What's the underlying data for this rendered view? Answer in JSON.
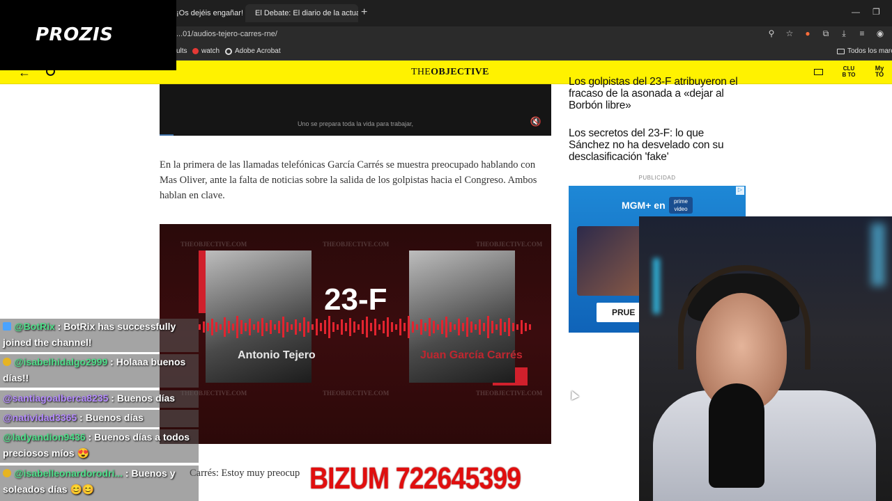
{
  "browser": {
    "tabs": [
      {
        "label": "¡Os dejéis engañar! ¡No"
      },
      {
        "label": "El Debate: El diario de la actual"
      }
    ],
    "url": "...01/audios-tejero-carres-rne/",
    "bookmarks": [
      {
        "label": "ults"
      },
      {
        "label": "watch"
      },
      {
        "label": "Adobe Acrobat"
      },
      {
        "label": "Todos los marcad"
      }
    ]
  },
  "overlay": {
    "sponsor": "PROZIS",
    "bizum": "BIZUM 722645399"
  },
  "site": {
    "logo_light": "THE",
    "logo_bold": "OBJECTIVE",
    "club_label": "CLUB TO",
    "my_label": "My TO"
  },
  "article": {
    "video_caption": "Uno se prepara toda la vida para trabajar,",
    "paragraph": "En la primera de las llamadas telefónicas García Carrés se muestra preocupado hablando con Mas Oliver, ante la falta de noticias sobre la salida de los golpistas hacia el Congreso. Ambos hablan en clave.",
    "figure": {
      "watermark": "THEOBJECTIVE.COM",
      "title": "23-F",
      "name_left": "Antonio Tejero",
      "name_right": "Juan García Carrés"
    },
    "quote_start": "Carrés: Estoy muy preocup"
  },
  "sidebar": {
    "headline1": "Los golpistas del 23-F atribuyeron el fracaso de la asonada a «dejar al Borbón libre»",
    "headline2": "Los secretos del 23-F: lo que Sánchez no ha desvelado con su desclasificación 'fake'",
    "pub_label": "PUBLICIDAD",
    "ad": {
      "brand": "MGM+ en",
      "prime": "prime video",
      "cta": "PRUE"
    }
  },
  "chat": [
    {
      "user": "@BotRix",
      "text": ": BotRix has successfully joined the channel!",
      "style": "green",
      "icon": "wrench"
    },
    {
      "user": "@isabelhidalgo2999",
      "text": ": Holaaa buenos días!!",
      "style": "green",
      "icon": "smile"
    },
    {
      "user": "@santiagoalberca8235",
      "text": ": Buenos días",
      "style": "purple",
      "icon": ""
    },
    {
      "user": "@natividad3365",
      "text": ": Buenos días",
      "style": "purple",
      "icon": ""
    },
    {
      "user": "@ladyandion9436",
      "text": ": Buenos días a todos preciosos míos 😍",
      "style": "green",
      "icon": ""
    },
    {
      "user": "@isabelleonardorodri...",
      "text": ": Buenos y soleados días 😊😊",
      "style": "green",
      "icon": "smile"
    }
  ]
}
